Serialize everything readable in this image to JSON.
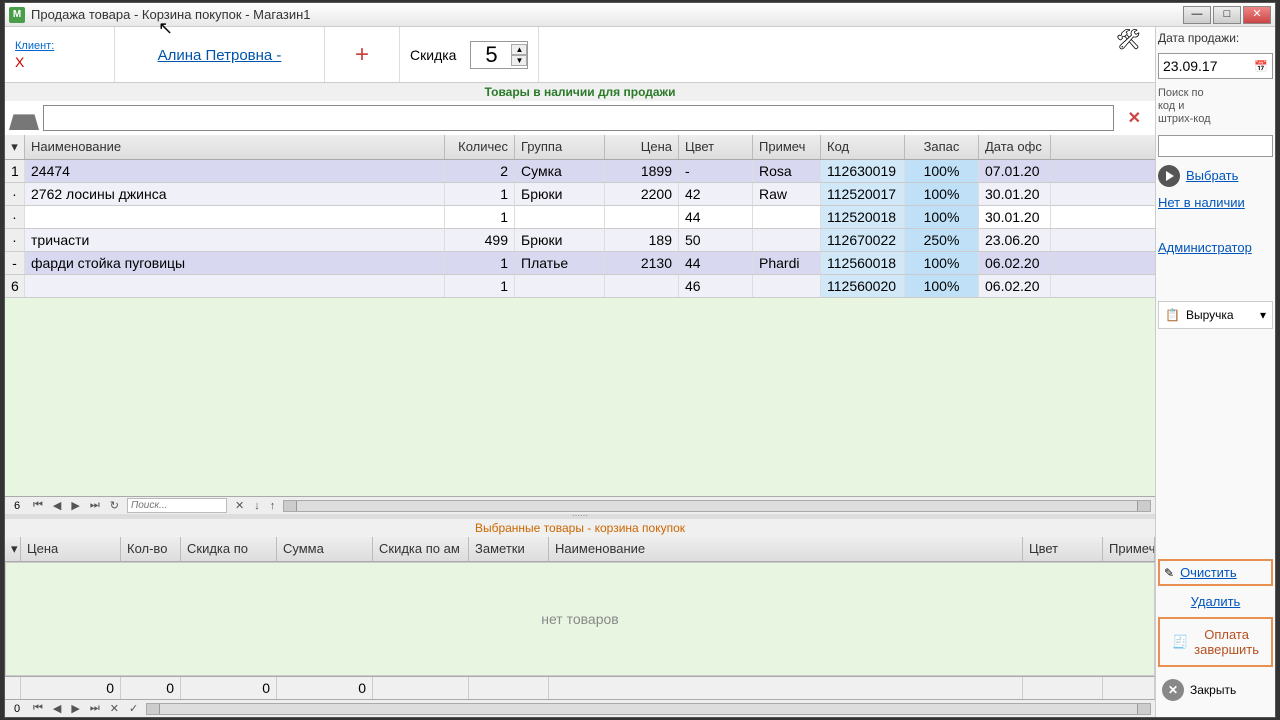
{
  "title": "Продажа товара - Корзина покупок - Магазин1",
  "toolbar": {
    "client_label": "Клиент:",
    "client_name": "Алина Петровна -",
    "client_x": "X",
    "plus": "+",
    "discount_label": "Скидка",
    "discount_value": "5"
  },
  "sale_date_label": "Дата продажи:",
  "sale_date": "23.09.17",
  "section_available": "Товары в наличии для продажи",
  "section_cart": "Выбранные товары - корзина покупок",
  "cart_empty": "нет товаров",
  "top_count": "6",
  "bottom_count": "0",
  "nav_placeholder": "Поиск...",
  "headers": {
    "name": "Наименование",
    "qty": "Количес",
    "group": "Группа",
    "price": "Цена",
    "color": "Цвет",
    "note": "Примеч",
    "code": "Код",
    "stock": "Запас",
    "date": "Дата офс"
  },
  "rows": [
    {
      "idx": "1",
      "name": "24474",
      "qty": "2",
      "group": "Сумка",
      "price": "1899",
      "color": "-",
      "note": "Rosa",
      "code": "112630019",
      "stock": "100%",
      "date": "07.01.20"
    },
    {
      "idx": "·",
      "name": "2762 лосины джинса",
      "qty": "1",
      "group": "Брюки",
      "price": "2200",
      "color": "42",
      "note": "Raw",
      "code": "112520017",
      "stock": "100%",
      "date": "30.01.20"
    },
    {
      "idx": "·",
      "name": "",
      "qty": "1",
      "group": "",
      "price": "",
      "color": "44",
      "note": "",
      "code": "112520018",
      "stock": "100%",
      "date": "30.01.20"
    },
    {
      "idx": "·",
      "name": "тричасти",
      "qty": "499",
      "group": "Брюки",
      "price": "189",
      "color": "50",
      "note": "",
      "code": "112670022",
      "stock": "250%",
      "date": "23.06.20"
    },
    {
      "idx": "-",
      "name": "фарди стойка пуговицы",
      "qty": "1",
      "group": "Платье",
      "price": "2130",
      "color": "44",
      "note": "Phardi",
      "code": "112560018",
      "stock": "100%",
      "date": "06.02.20"
    },
    {
      "idx": "6",
      "name": "",
      "qty": "1",
      "group": "",
      "price": "",
      "color": "46",
      "note": "",
      "code": "112560020",
      "stock": "100%",
      "date": "06.02.20"
    }
  ],
  "cart_headers": {
    "price": "Цена",
    "qty": "Кол-во",
    "discount": "Скидка по",
    "sum": "Сумма",
    "discount_amt": "Скидка по ам",
    "notes": "Заметки",
    "name": "Наименование",
    "color": "Цвет",
    "note2": "Примеч"
  },
  "cart_totals": {
    "price": "0",
    "qty": "0",
    "disc": "0",
    "sum": "0"
  },
  "right": {
    "search_label": "Поиск по\nкод и\nштрих-код",
    "select": "Выбрать",
    "not_in_stock": "Нет в наличии",
    "admin": "Администратор",
    "revenue": "Выручка",
    "clear": "Очистить",
    "delete": "Удалить",
    "pay1": "Оплата",
    "pay2": "завершить",
    "close": "Закрыть"
  }
}
